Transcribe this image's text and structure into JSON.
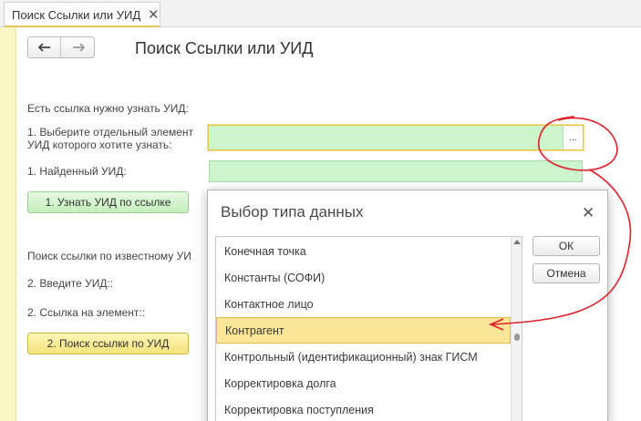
{
  "tab": {
    "label": "Поиск Ссылки или УИД",
    "close": "✕"
  },
  "page": {
    "title": "Поиск Ссылки или УИД"
  },
  "section1": {
    "heading": "Есть ссылка нужно узнать УИД:",
    "select_label_line1": "1. Выберите отдельный элемент",
    "select_label_line2": "УИД которого хотите узнать:",
    "select_value": "",
    "pick_button": "...",
    "found_label": "1. Найденный УИД:",
    "found_value": "",
    "action_button": "1. Узнать УИД по ссылке"
  },
  "section2": {
    "heading": "Поиск ссылки по известному УИ",
    "uid_label": "2. Введите УИД::",
    "ref_label": "2. Ссылка на элемент::",
    "action_button": "2. Поиск ссылки по УИД"
  },
  "dialog": {
    "title": "Выбор типа данных",
    "close": "✕",
    "ok_button": "ОК",
    "cancel_button": "Отмена",
    "items": [
      "Конечная точка",
      "Константы (СОФИ)",
      "Контактное лицо",
      "Контрагент",
      "Контрольный (идентификационный) знак ГИСМ",
      "Корректировка долга",
      "Корректировка поступления"
    ],
    "selected_index": 3
  },
  "colors": {
    "accent_yellow": "#e6c75f",
    "field_green": "#ccf5cc",
    "annotation_red": "#e0202a"
  }
}
